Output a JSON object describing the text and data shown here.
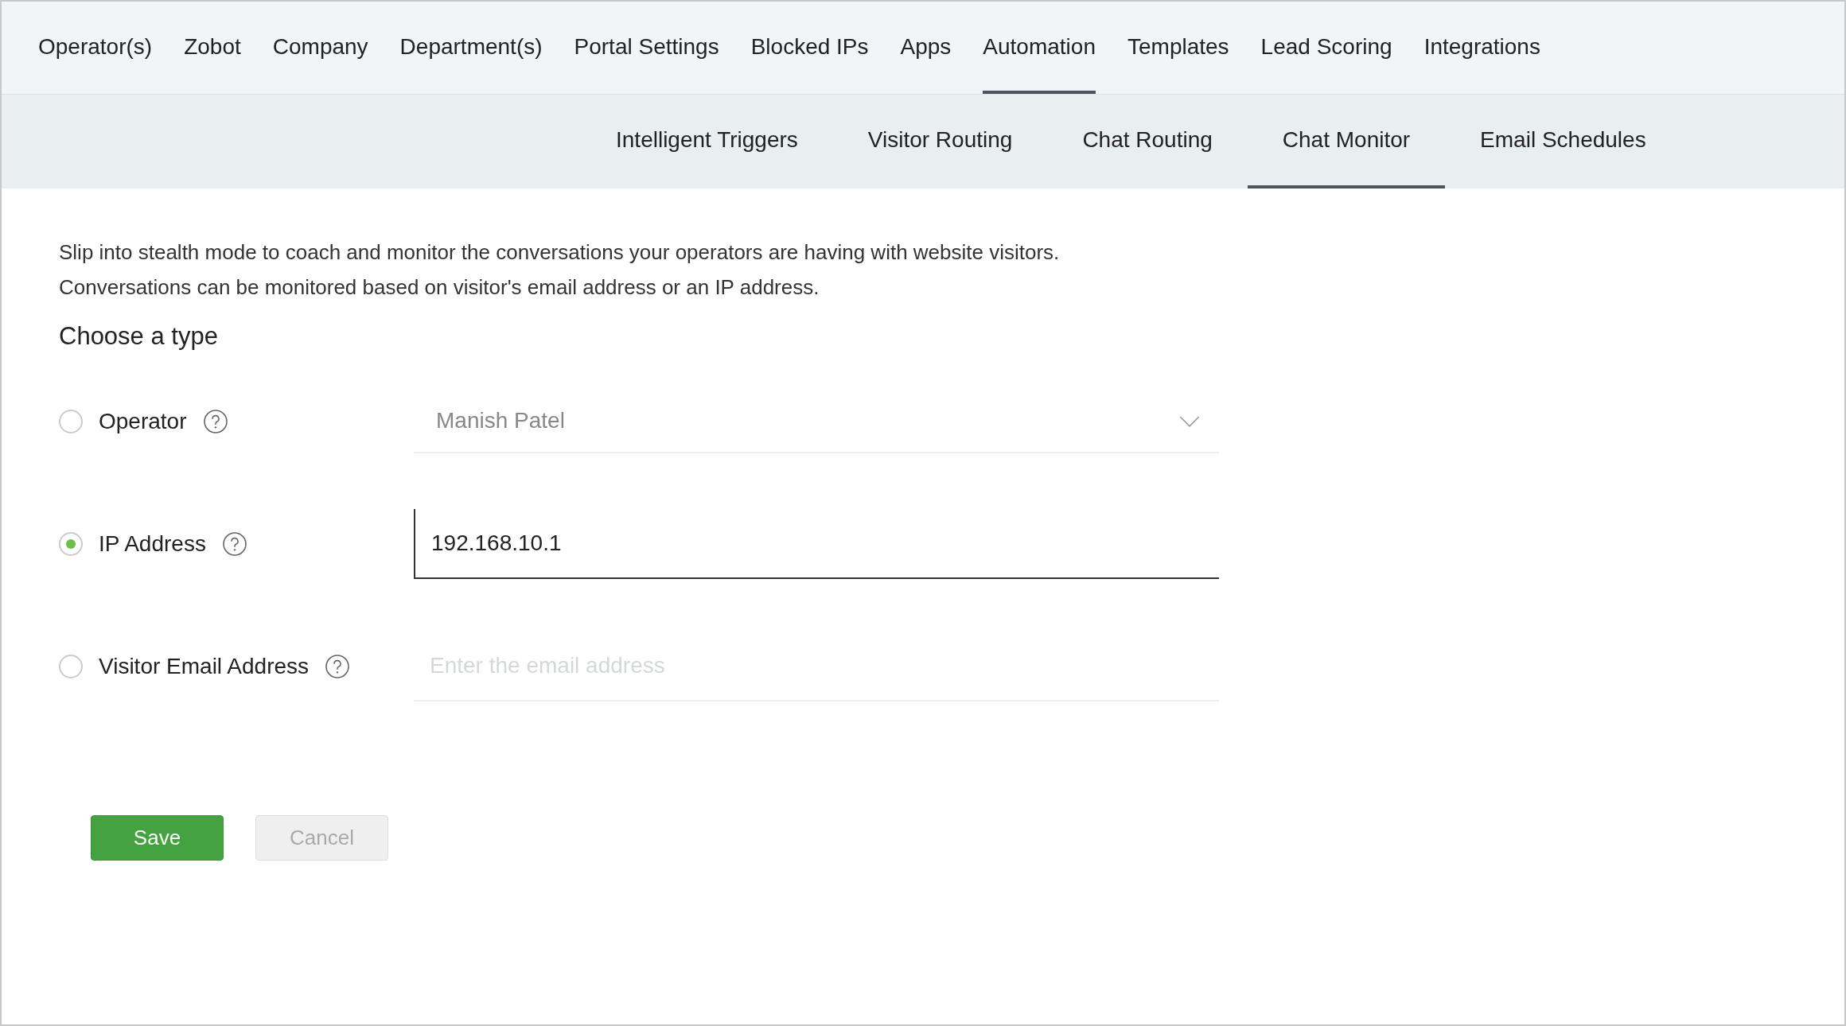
{
  "top_tabs": [
    {
      "label": "Operator(s)",
      "selected": false
    },
    {
      "label": "Zobot",
      "selected": false
    },
    {
      "label": "Company",
      "selected": false
    },
    {
      "label": "Department(s)",
      "selected": false
    },
    {
      "label": "Portal Settings",
      "selected": false
    },
    {
      "label": "Blocked IPs",
      "selected": false
    },
    {
      "label": "Apps",
      "selected": false
    },
    {
      "label": "Automation",
      "selected": true
    },
    {
      "label": "Templates",
      "selected": false
    },
    {
      "label": "Lead Scoring",
      "selected": false
    },
    {
      "label": "Integrations",
      "selected": false
    }
  ],
  "sub_tabs": [
    {
      "label": "Intelligent Triggers",
      "selected": false
    },
    {
      "label": "Visitor Routing",
      "selected": false
    },
    {
      "label": "Chat Routing",
      "selected": false
    },
    {
      "label": "Chat Monitor",
      "selected": true
    },
    {
      "label": "Email Schedules",
      "selected": false
    }
  ],
  "description": [
    "Slip into stealth mode to coach and monitor the conversations your operators are having with website visitors.",
    "Conversations can be monitored based on visitor's email address or an IP address."
  ],
  "section_title": "Choose a type",
  "options": [
    {
      "label": "Operator",
      "selected": false,
      "field": {
        "kind": "dropdown",
        "value": "Manish Patel"
      }
    },
    {
      "label": "IP Address",
      "selected": true,
      "field": {
        "kind": "input",
        "value": "192.168.10.1"
      }
    },
    {
      "label": "Visitor Email Address",
      "selected": false,
      "field": {
        "kind": "input",
        "placeholder": "Enter the email address"
      }
    }
  ],
  "buttons": [
    {
      "label": "Save",
      "kind": "primary"
    },
    {
      "label": "Cancel",
      "kind": "secondary"
    }
  ]
}
